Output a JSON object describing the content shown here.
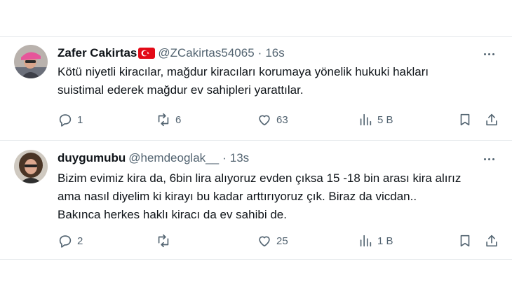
{
  "tweets": [
    {
      "author_name": "Zafer Cakirtas",
      "flag_icon": "turkey-flag-icon",
      "handle": "@ZCakirtas54065",
      "separator": "·",
      "time": "16s",
      "text_lines": [
        "Kötü niyetli kiracılar, mağdur kiracıları korumaya yönelik hukuki hakları",
        "suistimal ederek mağdur ev sahipleri yarattılar."
      ],
      "replies": "1",
      "reposts": "6",
      "likes": "63",
      "views": "5 B"
    },
    {
      "author_name": "duygumubu",
      "handle": "@hemdeoglak__",
      "separator": "·",
      "time": "13s",
      "text_lines": [
        "Bizim evimiz kira da, 6bin lira alıyoruz evden çıksa 15 -18 bin arası kira alırız",
        "ama nasıl diyelim ki kirayı bu kadar arttırıyoruz çık. Biraz da vicdan..",
        "Bakınca herkes haklı kiracı da ev sahibi de."
      ],
      "replies": "2",
      "reposts": "",
      "likes": "25",
      "views": "1 B"
    }
  ],
  "colors": {
    "text_primary": "#0f1419",
    "text_secondary": "#536471",
    "divider": "#e6e9ec",
    "flag_red": "#e30a17"
  }
}
